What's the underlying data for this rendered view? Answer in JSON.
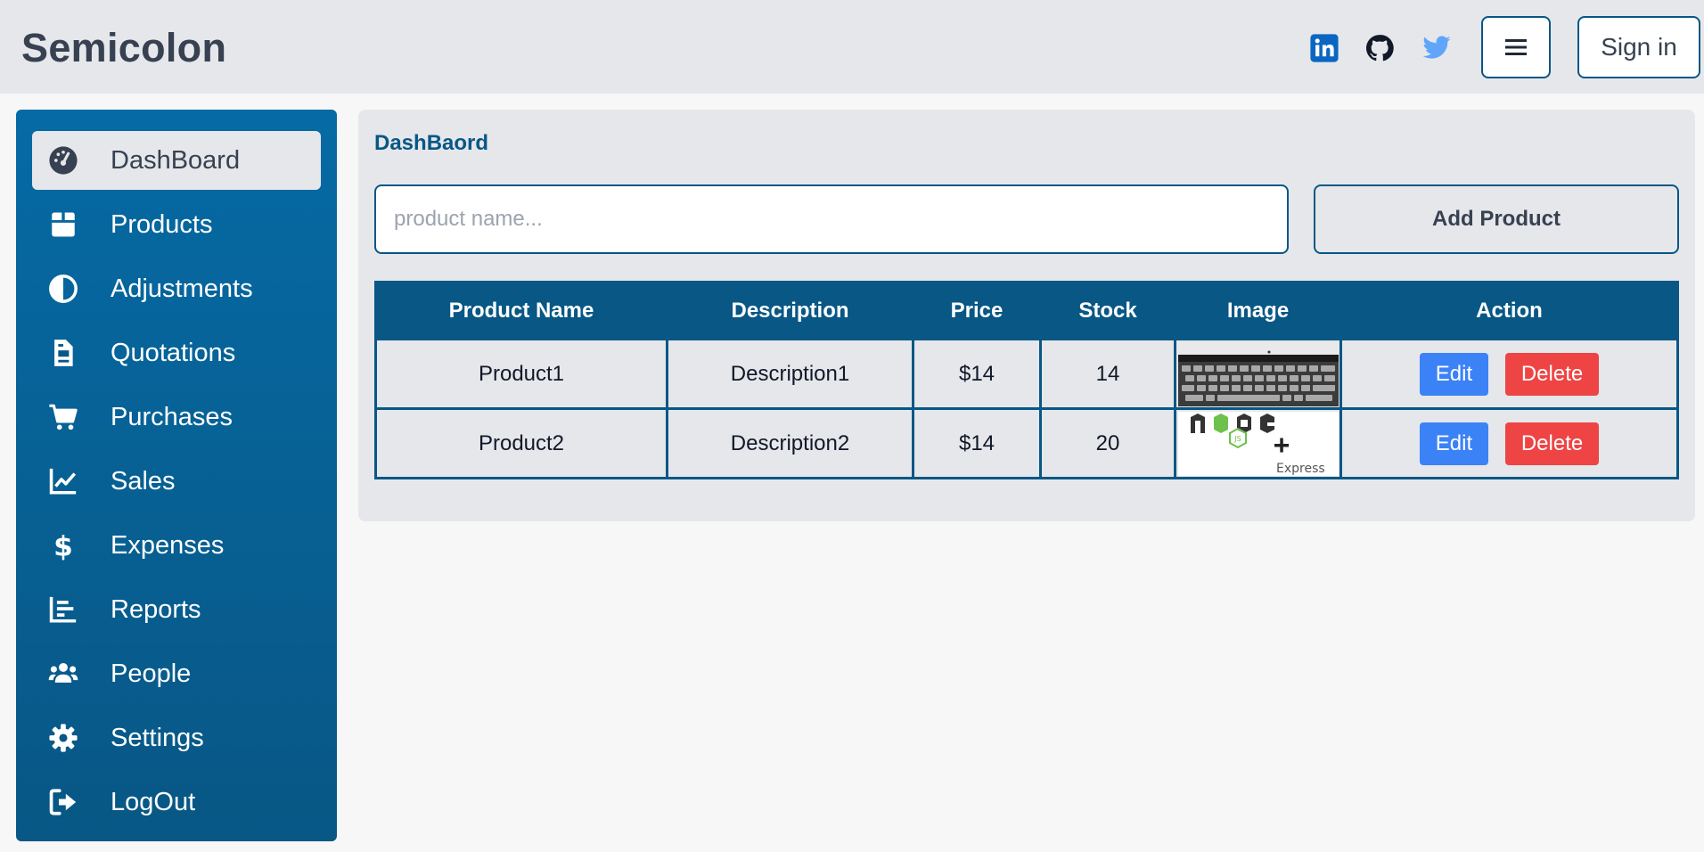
{
  "header": {
    "brand": "Semicolon",
    "social": [
      {
        "name": "linkedin-icon",
        "color": "#0a66c2"
      },
      {
        "name": "github-icon",
        "color": "#111827"
      },
      {
        "name": "twitter-icon",
        "color": "#60a5fa"
      }
    ],
    "menu_icon": "hamburger-icon",
    "signin_label": "Sign in"
  },
  "sidebar": {
    "items": [
      {
        "label": "DashBoard",
        "icon": "gauge-icon",
        "active": true
      },
      {
        "label": "Products",
        "icon": "box-icon"
      },
      {
        "label": "Adjustments",
        "icon": "half-circle-icon"
      },
      {
        "label": "Quotations",
        "icon": "document-icon"
      },
      {
        "label": "Purchases",
        "icon": "cart-icon"
      },
      {
        "label": "Sales",
        "icon": "line-chart-icon"
      },
      {
        "label": "Expenses",
        "icon": "dollar-icon"
      },
      {
        "label": "Reports",
        "icon": "bar-chart-icon"
      },
      {
        "label": "People",
        "icon": "users-icon"
      },
      {
        "label": "Settings",
        "icon": "gear-icon"
      },
      {
        "label": "LogOut",
        "icon": "logout-icon"
      }
    ]
  },
  "main": {
    "breadcrumb": "DashBaord",
    "search_placeholder": "product name...",
    "add_label": "Add Product",
    "table": {
      "headers": [
        "Product Name",
        "Description",
        "Price",
        "Stock",
        "Image",
        "Action"
      ],
      "rows": [
        {
          "name": "Product1",
          "description": "Description1",
          "price": "$14",
          "stock": "14",
          "image": "laptop-keyboard-image",
          "edit": "Edit",
          "delete": "Delete"
        },
        {
          "name": "Product2",
          "description": "Description2",
          "price": "$14",
          "stock": "20",
          "image": "node-express-logo-image",
          "edit": "Edit",
          "delete": "Delete"
        }
      ]
    }
  },
  "colors": {
    "primary": "#085785",
    "sidebar_top": "#066aa4",
    "edit": "#3b82f6",
    "delete": "#ef4444",
    "surface": "#e5e7eb"
  }
}
